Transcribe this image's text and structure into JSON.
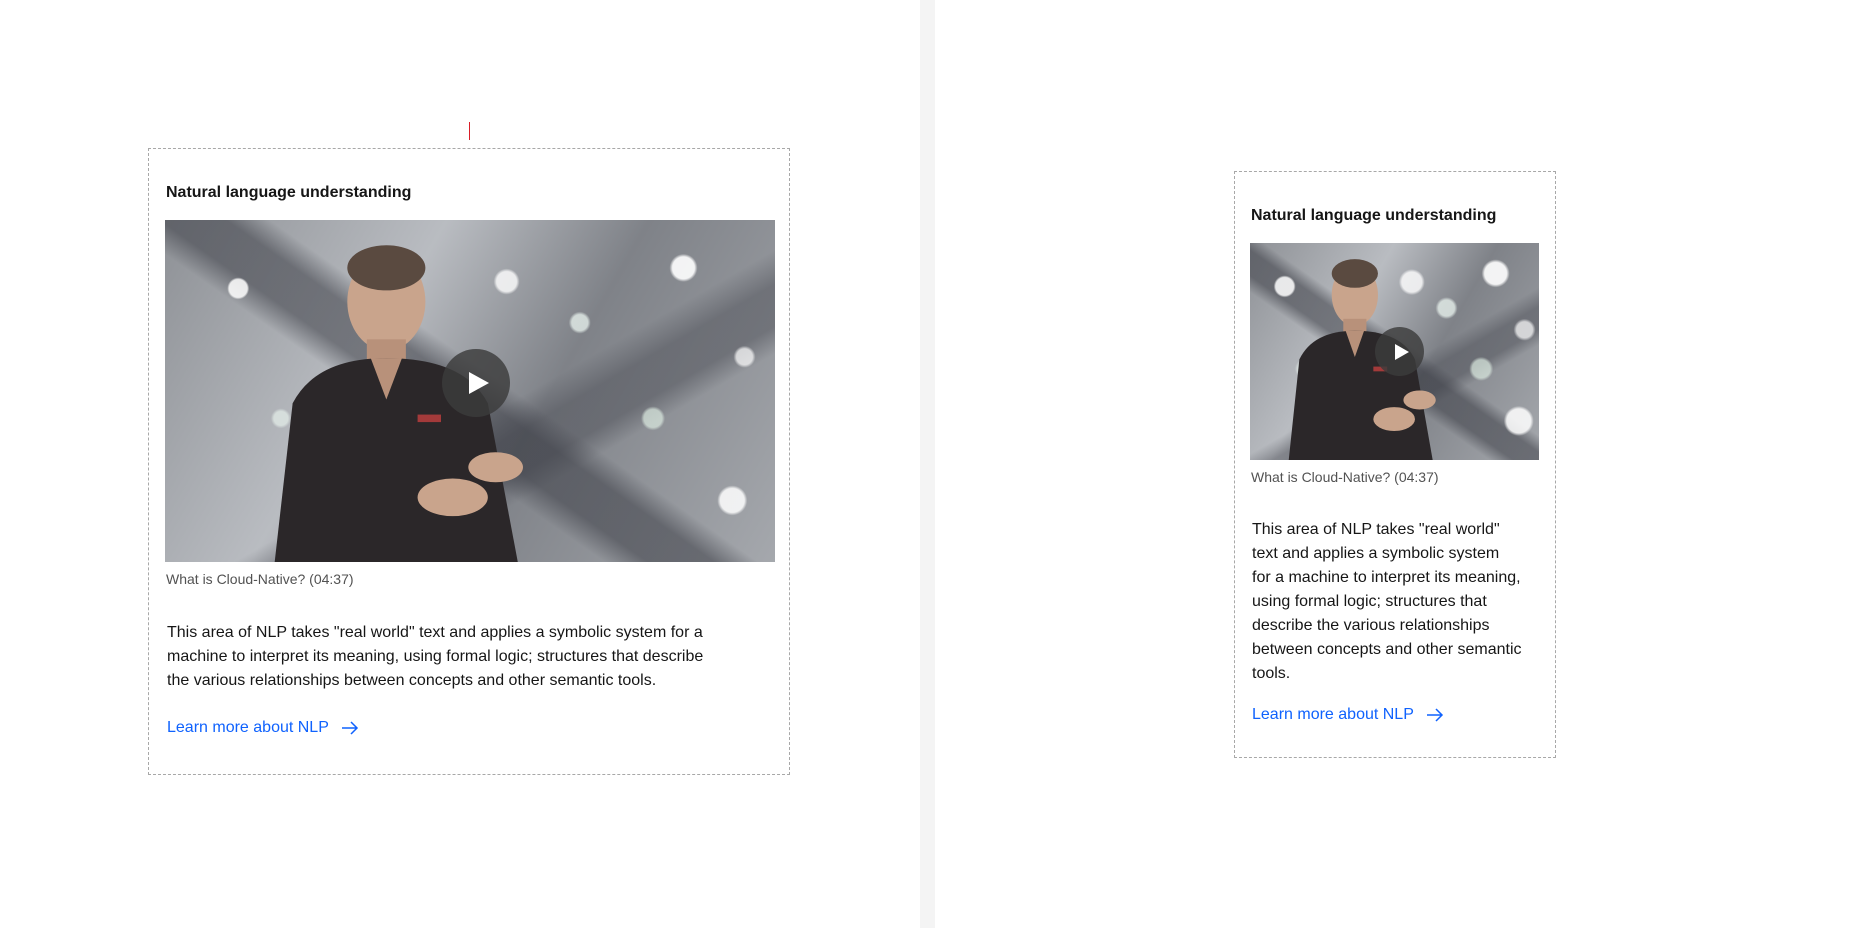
{
  "cards": [
    {
      "title": "Natural language understanding",
      "video_caption": "What is Cloud-Native? (04:37)",
      "description": "This area of NLP takes \"real world\" text and applies a symbolic system for a machine to interpret its meaning, using formal logic; structures that describe the various relationships between concepts and other semantic tools.",
      "link_label": "Learn more about NLP",
      "play_icon": "play-icon",
      "link_icon": "arrow-right-icon"
    },
    {
      "title": "Natural language understanding",
      "video_caption": "What is Cloud-Native? (04:37)",
      "description": "This area of NLP takes \"real world\" text and applies a symbolic system for a machine to interpret its meaning, using formal logic; structures that describe the various relationships between concepts and other semantic tools.",
      "link_label": "Learn more about NLP",
      "play_icon": "play-icon",
      "link_icon": "arrow-right-icon"
    }
  ],
  "colors": {
    "link": "#0f62fe",
    "divider": "#f4f4f4",
    "card_border": "#a8a8a8",
    "focus_mark": "#da1e28"
  }
}
